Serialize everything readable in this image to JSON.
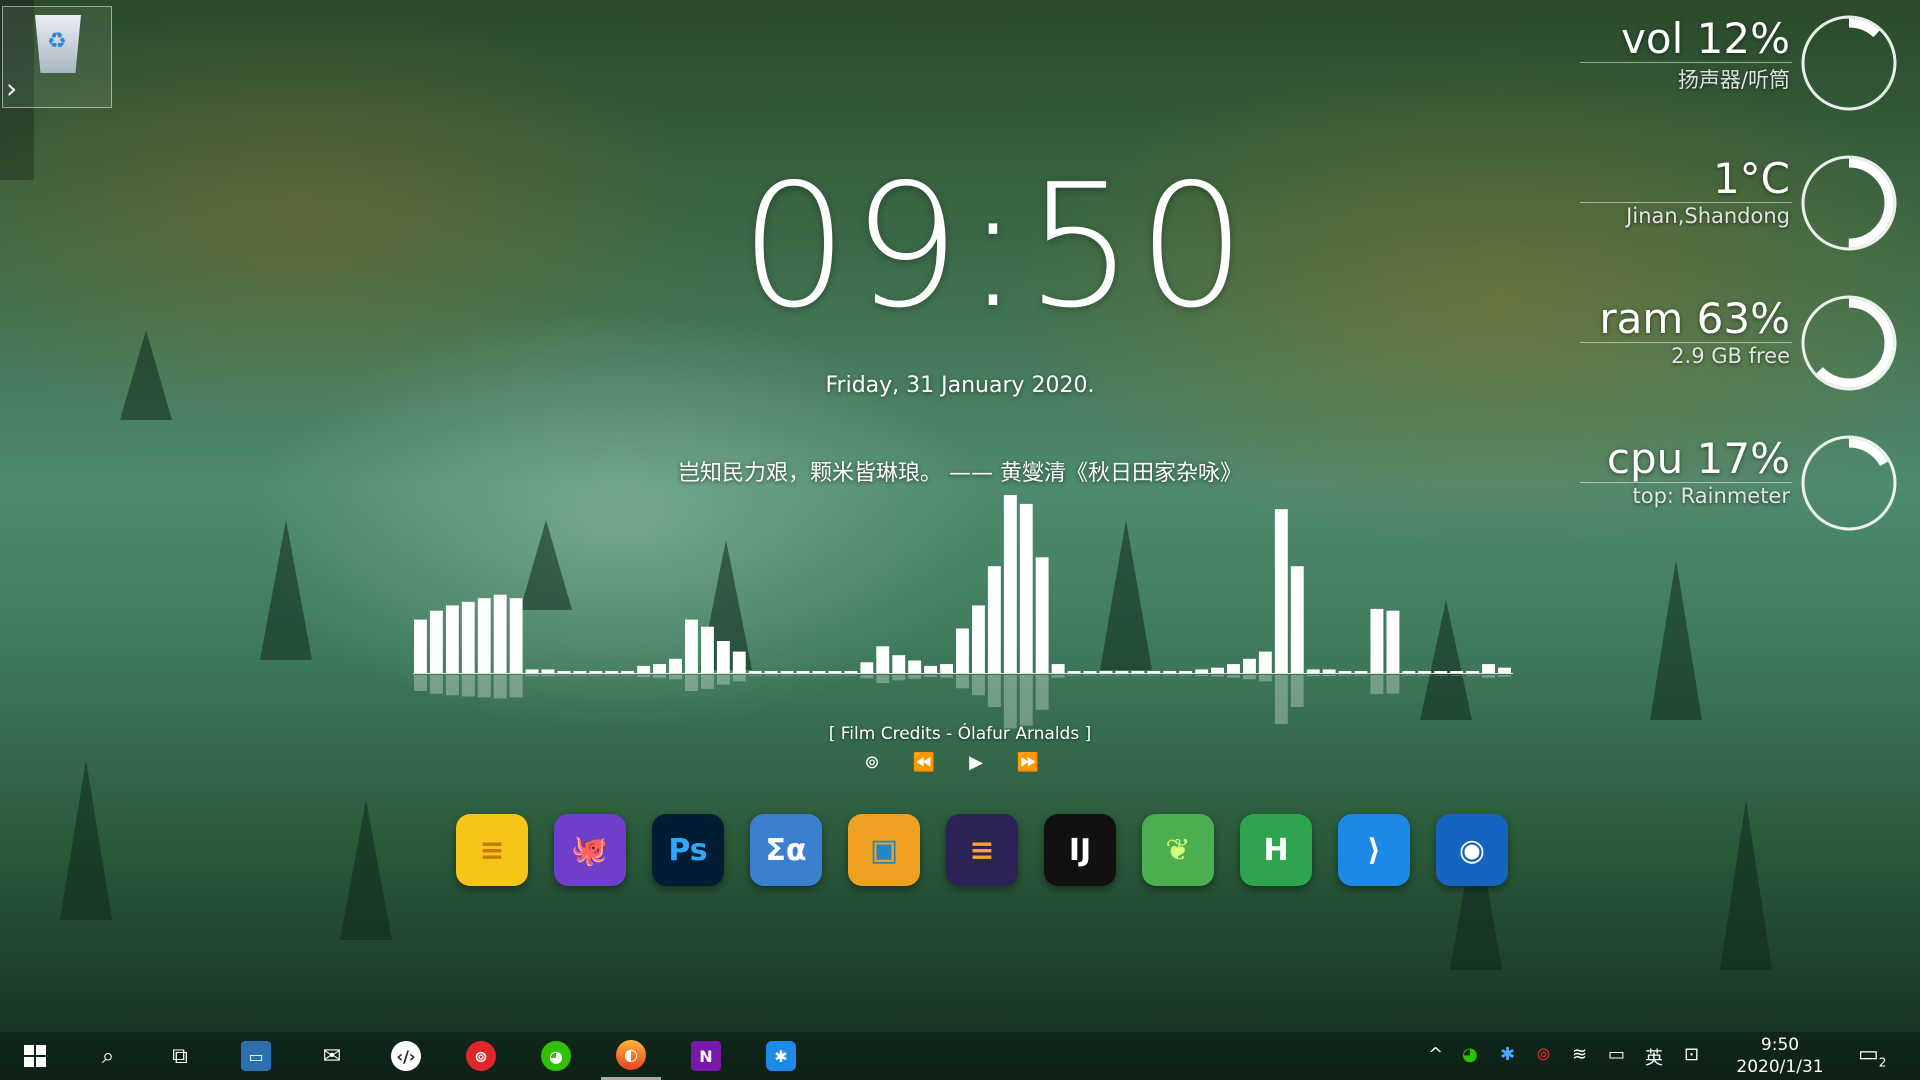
{
  "clock": {
    "time": "09:50",
    "date": "Friday, 31 January 2020."
  },
  "quote": "岂知民力艰，颗米皆琳琅。 —— 黄燮清《秋日田家杂咏》",
  "music": {
    "song": "[  Film Credits - Ólafur Arnalds  ]",
    "controls": [
      "netease-music-icon",
      "previous-icon",
      "play-icon",
      "next-icon"
    ],
    "spectrum": [
      0.3,
      0.35,
      0.38,
      0.4,
      0.42,
      0.44,
      0.42,
      0.02,
      0.02,
      0,
      0,
      0,
      0,
      0,
      0.04,
      0.05,
      0.08,
      0.3,
      0.26,
      0.18,
      0.12,
      0,
      0,
      0,
      0,
      0,
      0,
      0,
      0.06,
      0.15,
      0.1,
      0.07,
      0.04,
      0.05,
      0.25,
      0.38,
      0.6,
      1.0,
      0.95,
      0.65,
      0.05,
      0,
      0,
      0,
      0,
      0,
      0,
      0,
      0,
      0.02,
      0.03,
      0.05,
      0.08,
      0.12,
      0.92,
      0.6,
      0.02,
      0.02,
      0,
      0,
      0.36,
      0.35,
      0,
      0,
      0,
      0,
      0,
      0.05,
      0.03
    ]
  },
  "dock": [
    {
      "name": "notes-app",
      "label": "≡",
      "bg": "#f5c518",
      "fg": "#c47a00"
    },
    {
      "name": "github-desktop-app",
      "label": "🐙",
      "bg": "#6e40c9",
      "fg": "#ffffff"
    },
    {
      "name": "photoshop-app",
      "label": "Ps",
      "bg": "#001d34",
      "fg": "#31a8ff"
    },
    {
      "name": "mathtype-app",
      "label": "Σα",
      "bg": "#3a7fd0",
      "fg": "#ffffff"
    },
    {
      "name": "window-app",
      "label": "▣",
      "bg": "#f0a020",
      "fg": "#1e88c8"
    },
    {
      "name": "eclipse-app",
      "label": "≡",
      "bg": "#2c2255",
      "fg": "#f5a623"
    },
    {
      "name": "intellij-idea-app",
      "label": "IJ",
      "bg": "#111111",
      "fg": "#ffffff"
    },
    {
      "name": "leaf-app",
      "label": "❦",
      "bg": "#4caf50",
      "fg": "#d6ff7a"
    },
    {
      "name": "hbuilder-app",
      "label": "H",
      "bg": "#2ea44f",
      "fg": "#ffffff"
    },
    {
      "name": "vscode-app",
      "label": "⟩",
      "bg": "#1e88e5",
      "fg": "#ffffff"
    },
    {
      "name": "eye-app",
      "label": "◉",
      "bg": "#1565c0",
      "fg": "#ffffff"
    }
  ],
  "meters": [
    {
      "id": "vol",
      "big": "vol 12%",
      "sub": "扬声器/听筒",
      "level": 0.12
    },
    {
      "id": "weather",
      "big": "1°C",
      "sub": "Jinan,Shandong",
      "level": 0.5
    },
    {
      "id": "ram",
      "big": "ram 63%",
      "sub": "2.9 GB free",
      "level": 0.63
    },
    {
      "id": "cpu",
      "big": "cpu 17%",
      "sub": "top: Rainmeter",
      "level": 0.17
    }
  ],
  "taskbar": {
    "start_icon": "windows-start-icon",
    "ime": "英",
    "time": "9:50",
    "date": "2020/1/31",
    "notification_count": "2"
  },
  "colors": {
    "accent": "#ffffff",
    "taskbar": "#0a1914"
  }
}
